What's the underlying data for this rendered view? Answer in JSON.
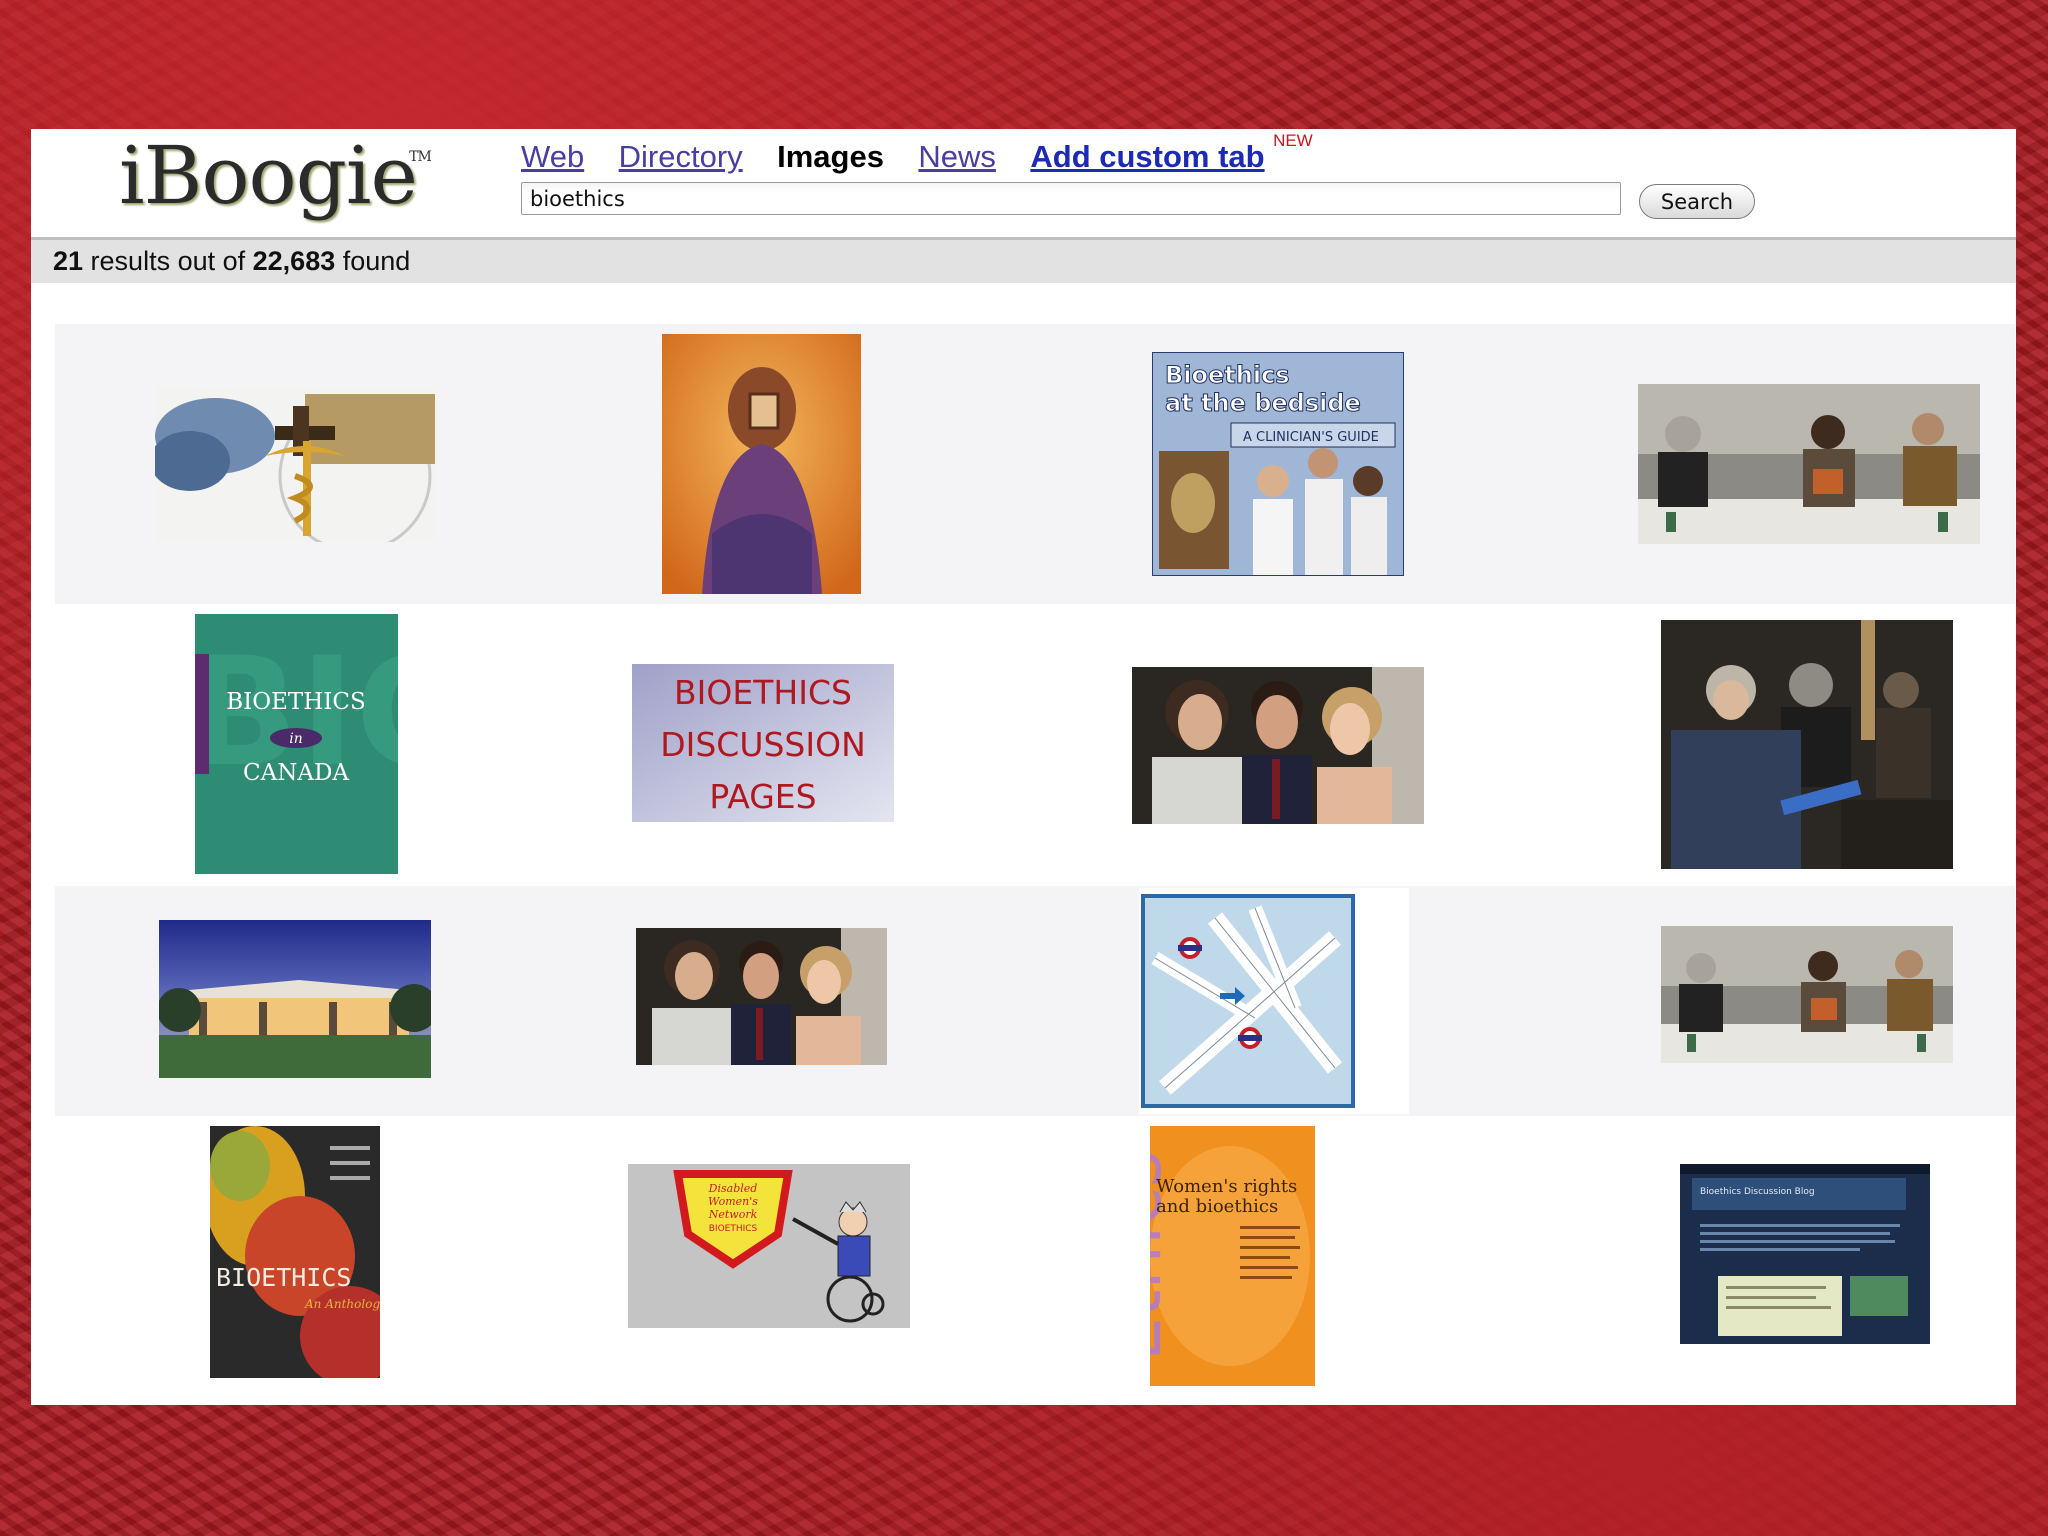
{
  "header": {
    "logo_text": "iBoogie",
    "logo_tm": "TM",
    "tabs": [
      {
        "label": "Web"
      },
      {
        "label": "Directory"
      },
      {
        "label": "Images"
      },
      {
        "label": "News"
      },
      {
        "label": "Add custom tab"
      }
    ],
    "new_badge": "NEW",
    "search_value": "bioethics",
    "search_button": "Search"
  },
  "results": {
    "count": "21",
    "mid_text": " results out of ",
    "total": "22,683",
    "end_text": " found"
  },
  "thumbnails": [
    {
      "name": "caduceus-gavel"
    },
    {
      "name": "figure-with-mirror"
    },
    {
      "name": "bioethics-at-bedside-cover",
      "lines": [
        "Bioethics",
        "at the bedside",
        "A CLINICIAN'S GUIDE"
      ]
    },
    {
      "name": "panel-discussion"
    },
    {
      "name": "bioethics-in-canada-cover",
      "lines": [
        "BIOETHICS",
        "in",
        "CANADA"
      ]
    },
    {
      "name": "bioethics-discussion-pages",
      "lines": [
        "BIOETHICS",
        "DISCUSSION",
        "PAGES"
      ]
    },
    {
      "name": "three-people-photo"
    },
    {
      "name": "group-discussion"
    },
    {
      "name": "building-at-dusk"
    },
    {
      "name": "three-people-photo-2"
    },
    {
      "name": "street-map"
    },
    {
      "name": "panel-discussion-2"
    },
    {
      "name": "bioethics-anthology-cover",
      "lines": [
        "BIOETHICS",
        "An Anthology"
      ]
    },
    {
      "name": "disabled-womens-network",
      "lines": [
        "Disabled",
        "Women's",
        "Network",
        "BIOETHICS"
      ]
    },
    {
      "name": "womens-rights-cover",
      "lines": [
        "Women's rights",
        "and bioethics",
        "Ethics"
      ]
    },
    {
      "name": "discussion-blog-screenshot",
      "lines": [
        "Bioethics Discussion Blog"
      ]
    }
  ]
}
